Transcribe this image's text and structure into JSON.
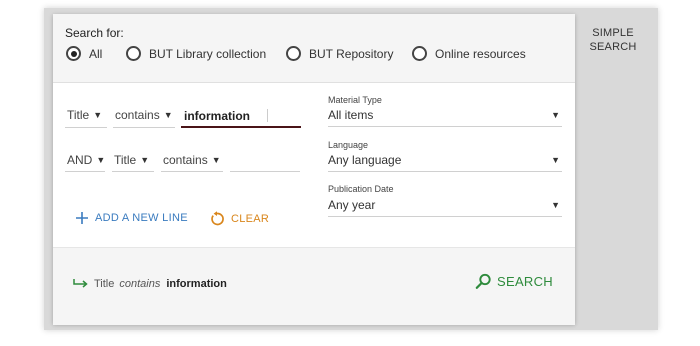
{
  "search_for_label": "Search for:",
  "scopes": [
    {
      "label": "All",
      "checked": true
    },
    {
      "label": "BUT Library collection",
      "checked": false
    },
    {
      "label": "BUT Repository",
      "checked": false
    },
    {
      "label": "Online resources",
      "checked": false
    }
  ],
  "rows": [
    {
      "field": "Title",
      "operator": "contains",
      "value": "information"
    },
    {
      "boolean": "AND",
      "field": "Title",
      "operator": "contains",
      "value": ""
    }
  ],
  "filters": {
    "material_type": {
      "label": "Material Type",
      "value": "All items"
    },
    "language": {
      "label": "Language",
      "value": "Any language"
    },
    "publication_date": {
      "label": "Publication Date",
      "value": "Any year"
    }
  },
  "actions": {
    "add_line": "ADD A NEW LINE",
    "clear": "CLEAR"
  },
  "summary": {
    "field": "Title",
    "operator": "contains",
    "query": "information"
  },
  "search_button": "SEARCH",
  "simple_search": {
    "line1": "SIMPLE",
    "line2": "SEARCH"
  },
  "colors": {
    "add": "#3a7bbf",
    "clear": "#d9861c",
    "search": "#2e8b3c",
    "active_underline": "#4a1418"
  }
}
